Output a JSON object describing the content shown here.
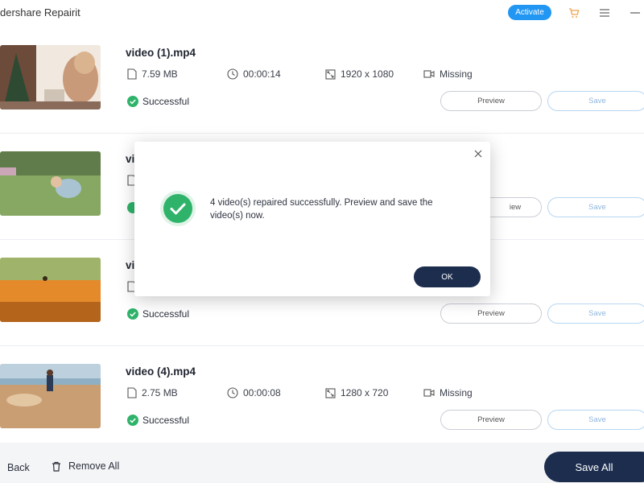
{
  "app": {
    "title": "dershare Repairit"
  },
  "titlebar": {
    "activate_label": "Activate",
    "accent_color": "#2196f3"
  },
  "videos": [
    {
      "name": "video (1).mp4",
      "size": "7.59  MB",
      "duration": "00:00:14",
      "resolution": "1920 x 1080",
      "audio": "Missing",
      "status": "Successful",
      "preview_label": "Preview",
      "save_label": "Save"
    },
    {
      "name": "vi",
      "size": "",
      "duration": "",
      "resolution": "",
      "audio": "",
      "status": "",
      "preview_label": "iew",
      "save_label": "Save"
    },
    {
      "name": "vi",
      "size": "",
      "duration": "",
      "resolution": "",
      "audio": "",
      "status": "Successful",
      "preview_label": "Preview",
      "save_label": "Save"
    },
    {
      "name": "video (4).mp4",
      "size": "2.75  MB",
      "duration": "00:00:08",
      "resolution": "1280 x 720",
      "audio": "Missing",
      "status": "Successful",
      "preview_label": "Preview",
      "save_label": "Save"
    }
  ],
  "footer": {
    "back_label": "Back",
    "remove_all_label": "Remove All",
    "save_all_label": "Save All"
  },
  "dialog": {
    "message": "4 video(s) repaired successfully. Preview and save the video(s) now.",
    "ok_label": "OK",
    "success_color": "#2fb36a"
  }
}
